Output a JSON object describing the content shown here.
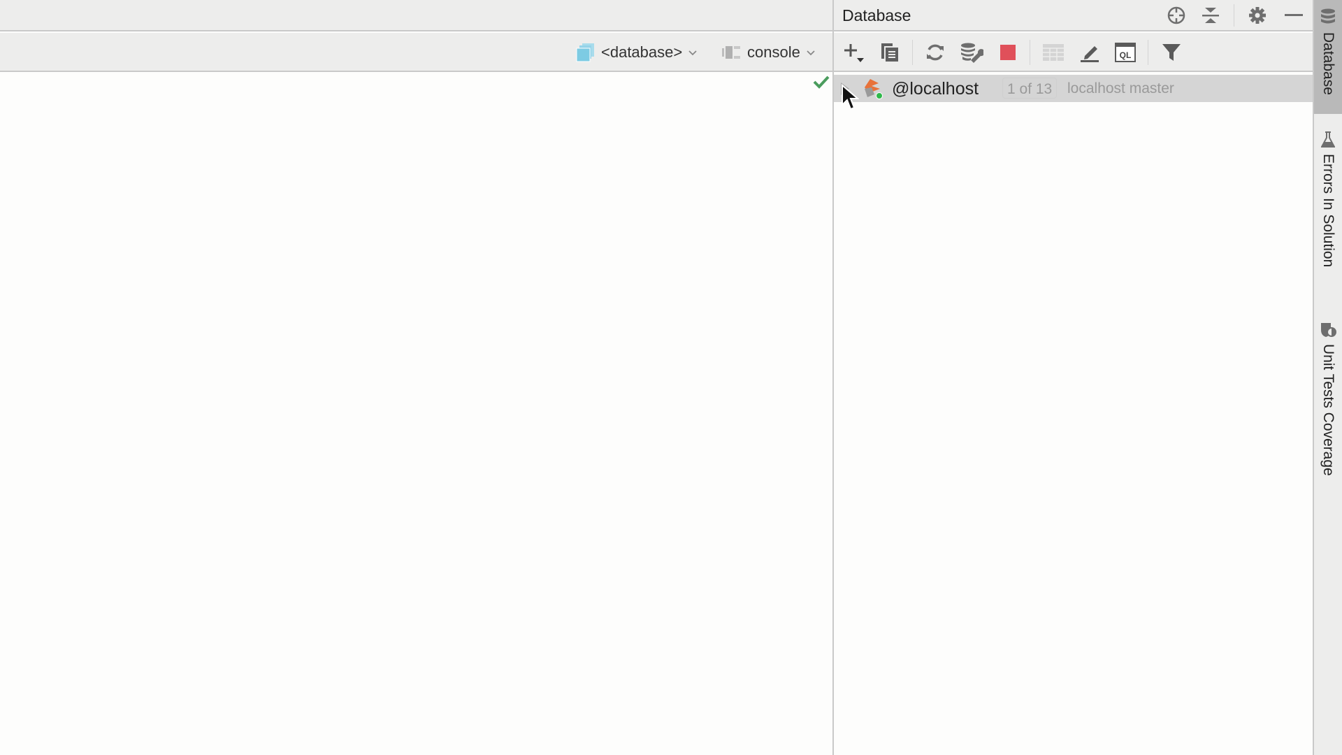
{
  "editor": {
    "database_selector": {
      "label": "<database>",
      "icon": "database-stack-icon"
    },
    "console_selector": {
      "label": "console",
      "icon": "console-icon"
    },
    "status_icon": "check-icon",
    "colors": {
      "check": "#4a9c5d",
      "db_icon": "#7dcbe3"
    }
  },
  "database_panel": {
    "title": "Database",
    "header_actions": [
      {
        "name": "locate",
        "icon": "crosshair-icon"
      },
      {
        "name": "collapse-all",
        "icon": "collapse-icon"
      },
      {
        "name": "settings",
        "icon": "gear-icon"
      },
      {
        "name": "hide",
        "icon": "minimize-icon"
      }
    ],
    "toolbar": [
      {
        "name": "add",
        "icon": "plus-icon"
      },
      {
        "name": "copy",
        "icon": "copy-icon"
      },
      {
        "name": "refresh",
        "icon": "refresh-icon"
      },
      {
        "name": "data-source-properties",
        "icon": "db-wrench-icon"
      },
      {
        "name": "disconnect",
        "icon": "stop-icon"
      },
      {
        "name": "table-editor",
        "icon": "table-icon"
      },
      {
        "name": "edit",
        "icon": "pencil-icon"
      },
      {
        "name": "jump-to-console",
        "icon": "ql-console-icon"
      },
      {
        "name": "filter",
        "icon": "filter-icon"
      }
    ],
    "tree": [
      {
        "name": "@localhost",
        "count": "1 of 13",
        "comment": "localhost master",
        "icon": "sql-server-icon",
        "connected": true,
        "expanded": false
      }
    ],
    "colors": {
      "stop": "#e0505a",
      "connected": "#2fb84a",
      "sqlserver": "#e8723a"
    }
  },
  "tool_stripe": {
    "tabs": [
      {
        "label": "Database",
        "icon": "database-icon",
        "active": true
      },
      {
        "label": "Errors In Solution",
        "icon": "flask-icon",
        "active": false
      },
      {
        "label": "Unit Tests Coverage",
        "icon": "coverage-shield-icon",
        "active": false
      }
    ]
  }
}
